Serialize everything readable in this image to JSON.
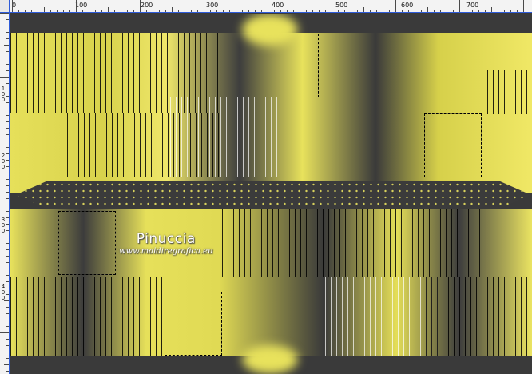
{
  "ruler": {
    "top_labels": [
      "0",
      "100",
      "200",
      "300",
      "400",
      "500",
      "600",
      "700"
    ],
    "left_labels": [
      "100",
      "200",
      "300",
      "400"
    ]
  },
  "watermark": {
    "name": "Pinuccia",
    "url": "www.maidiregrafica.eu"
  },
  "colors": {
    "yellow": "#e6e05a",
    "dark": "#3a3a3a",
    "ruler_bg": "#f3f3f3",
    "ruler_border": "#2e5bd8"
  }
}
